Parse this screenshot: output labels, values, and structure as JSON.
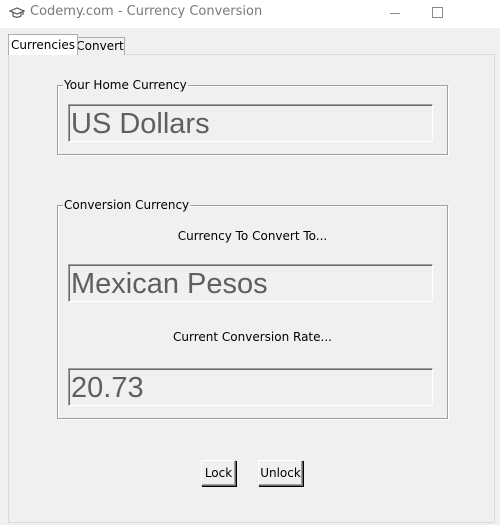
{
  "window": {
    "title": "Codemy.com - Currency Conversion",
    "icon": "graduation-cap-icon"
  },
  "tabs": [
    {
      "label": "Currencies",
      "selected": true
    },
    {
      "label": "Convert",
      "selected": false
    }
  ],
  "home_group": {
    "label": "Your Home Currency",
    "value": "US Dollars"
  },
  "conversion_group": {
    "label": "Conversion Currency",
    "convert_to_label": "Currency To Convert To...",
    "convert_to_value": "Mexican Pesos",
    "rate_label": "Current Conversion Rate...",
    "rate_value": "20.73"
  },
  "buttons": {
    "lock": "Lock",
    "unlock": "Unlock"
  },
  "colors": {
    "window_bg": "#f0f0f0",
    "field_text": "#5f5f5f",
    "title_text": "#7a7a7a"
  }
}
